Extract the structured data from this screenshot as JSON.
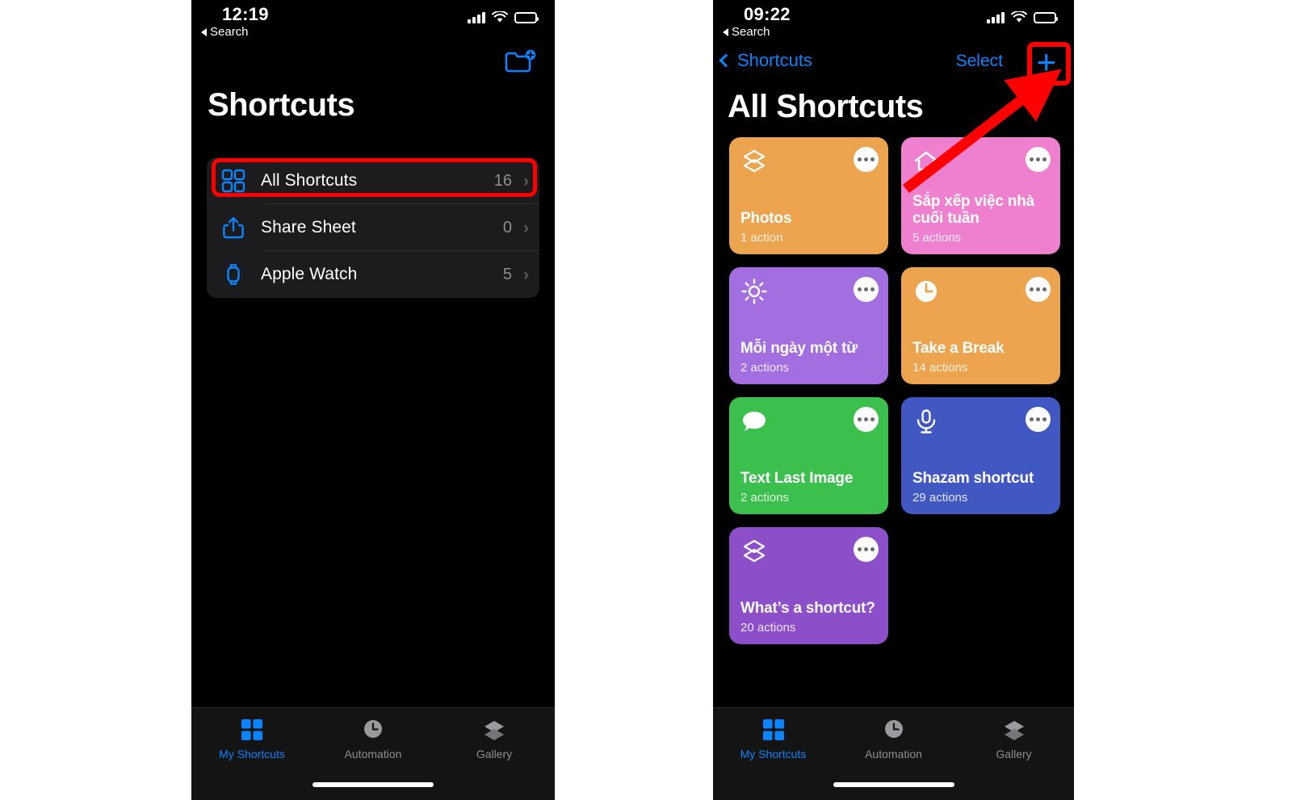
{
  "colors": {
    "accent_blue": "#0a84ff",
    "highlight_red": "#ff0000",
    "screen_black": "#000000",
    "list_bg": "#1c1c1e",
    "tabbar_bg": "#141414",
    "inactive_gray": "#8e8e93"
  },
  "left_phone": {
    "status": {
      "time": "12:19",
      "back_label": "Search",
      "signal_icon": "cellular-bars-icon",
      "wifi_icon": "wifi-icon",
      "battery_icon": "battery-icon"
    },
    "nav": {
      "folder_add_icon": "new-folder-icon"
    },
    "title": "Shortcuts",
    "list": [
      {
        "icon": "all-shortcuts-grid-icon",
        "label": "All Shortcuts",
        "count": "16",
        "chevron": "›"
      },
      {
        "icon": "share-sheet-icon",
        "label": "Share Sheet",
        "count": "0",
        "chevron": "›"
      },
      {
        "icon": "apple-watch-icon",
        "label": "Apple Watch",
        "count": "5",
        "chevron": "›"
      }
    ],
    "tabs": [
      {
        "icon": "grid-icon",
        "label": "My Shortcuts",
        "active": true
      },
      {
        "icon": "clock-icon",
        "label": "Automation",
        "active": false
      },
      {
        "icon": "layers-icon",
        "label": "Gallery",
        "active": false
      }
    ]
  },
  "right_phone": {
    "status": {
      "time": "09:22",
      "back_label": "Search",
      "signal_icon": "cellular-bars-icon",
      "wifi_icon": "wifi-icon",
      "battery_icon": "battery-icon"
    },
    "nav": {
      "back_label": "Shortcuts",
      "back_icon": "chevron-left-icon",
      "select_label": "Select",
      "add_label": "+",
      "add_icon": "plus-icon"
    },
    "title": "All Shortcuts",
    "cards": [
      {
        "name": "Photos",
        "actions": "1 action",
        "color": "#EDA44E",
        "glyph": "layers-icon",
        "menu": "more-options-icon"
      },
      {
        "name": "Sắp xếp việc nhà cuối tuần",
        "actions": "5 actions",
        "color": "#EE80CF",
        "glyph": "home-icon",
        "menu": "more-options-icon"
      },
      {
        "name": "Mỗi ngày một từ",
        "actions": "2 actions",
        "color": "#A36FE0",
        "glyph": "sun-icon",
        "menu": "more-options-icon"
      },
      {
        "name": "Take a Break",
        "actions": "14 actions",
        "color": "#EDA44E",
        "glyph": "clock-icon",
        "menu": "more-options-icon"
      },
      {
        "name": "Text Last Image",
        "actions": "2 actions",
        "color": "#3BBF4D",
        "glyph": "message-icon",
        "menu": "more-options-icon"
      },
      {
        "name": "Shazam shortcut",
        "actions": "29 actions",
        "color": "#4158C2",
        "glyph": "mic-icon",
        "menu": "more-options-icon"
      },
      {
        "name": "What’s a shortcut?",
        "actions": "20 actions",
        "color": "#8C4FC9",
        "glyph": "layers-icon",
        "menu": "more-options-icon"
      }
    ],
    "tabs": [
      {
        "icon": "grid-icon",
        "label": "My Shortcuts",
        "active": true
      },
      {
        "icon": "clock-icon",
        "label": "Automation",
        "active": false
      },
      {
        "icon": "layers-icon",
        "label": "Gallery",
        "active": false
      }
    ]
  },
  "annotations": [
    {
      "type": "rect-highlight",
      "target": "all-shortcuts-row",
      "color": "#ff0000"
    },
    {
      "type": "rect-highlight",
      "target": "add-shortcut-button",
      "color": "#ff0000"
    },
    {
      "type": "arrow",
      "target": "add-shortcut-button",
      "color": "#ff0000"
    }
  ]
}
